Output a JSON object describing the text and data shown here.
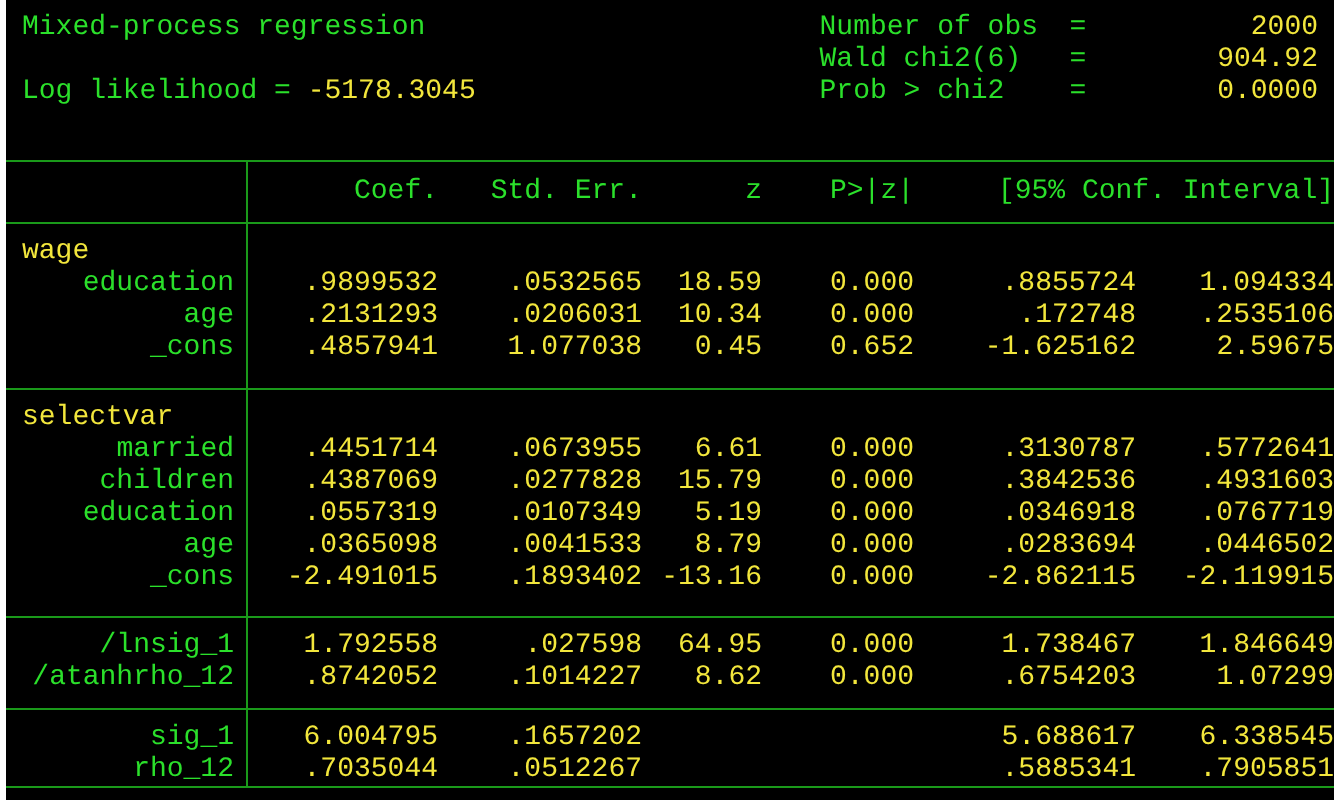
{
  "header": {
    "title": "Mixed-process regression",
    "log_likelihood": {
      "label": "Log likelihood",
      "separator": "=",
      "value": "-5178.3045"
    },
    "stats": [
      {
        "label": "Number of obs",
        "separator": "=",
        "value": "2000"
      },
      {
        "label": "Wald chi2(6)",
        "separator": "=",
        "value": "904.92"
      },
      {
        "label": "Prob > chi2",
        "separator": "=",
        "value": "0.0000"
      }
    ]
  },
  "columns": [
    "Coef.",
    "Std. Err.",
    "z",
    "P>|z|",
    "[95% Conf. Interval]"
  ],
  "sections": [
    {
      "name": "wage",
      "rows": [
        {
          "label": "education",
          "values": [
            ".9899532",
            ".0532565",
            "18.59",
            "0.000",
            ".8855724",
            "1.094334"
          ]
        },
        {
          "label": "age",
          "values": [
            ".2131293",
            ".0206031",
            "10.34",
            "0.000",
            ".172748",
            ".2535106"
          ]
        },
        {
          "label": "_cons",
          "values": [
            ".4857941",
            "1.077038",
            "0.45",
            "0.652",
            "-1.625162",
            "2.59675"
          ]
        }
      ]
    },
    {
      "name": "selectvar",
      "rows": [
        {
          "label": "married",
          "values": [
            ".4451714",
            ".0673955",
            "6.61",
            "0.000",
            ".3130787",
            ".5772641"
          ]
        },
        {
          "label": "children",
          "values": [
            ".4387069",
            ".0277828",
            "15.79",
            "0.000",
            ".3842536",
            ".4931603"
          ]
        },
        {
          "label": "education",
          "values": [
            ".0557319",
            ".0107349",
            "5.19",
            "0.000",
            ".0346918",
            ".0767719"
          ]
        },
        {
          "label": "age",
          "values": [
            ".0365098",
            ".0041533",
            "8.79",
            "0.000",
            ".0283694",
            ".0446502"
          ]
        },
        {
          "label": "_cons",
          "values": [
            "-2.491015",
            ".1893402",
            "-13.16",
            "0.000",
            "-2.862115",
            "-2.119915"
          ]
        }
      ]
    },
    {
      "rows": [
        {
          "label": "/lnsig_1",
          "values": [
            "1.792558",
            ".027598",
            "64.95",
            "0.000",
            "1.738467",
            "1.846649"
          ]
        },
        {
          "label": "/atanhrho_12",
          "values": [
            ".8742052",
            ".1014227",
            "8.62",
            "0.000",
            ".6754203",
            "1.07299"
          ]
        }
      ]
    },
    {
      "rows": [
        {
          "label": "sig_1",
          "values": [
            "6.004795",
            ".1657202"
          ],
          "interval": [
            "5.688617",
            "6.338545"
          ]
        },
        {
          "label": "rho_12",
          "values": [
            ".7035044",
            ".0512267"
          ],
          "interval": [
            ".5885341",
            ".7905851"
          ]
        }
      ]
    }
  ]
}
